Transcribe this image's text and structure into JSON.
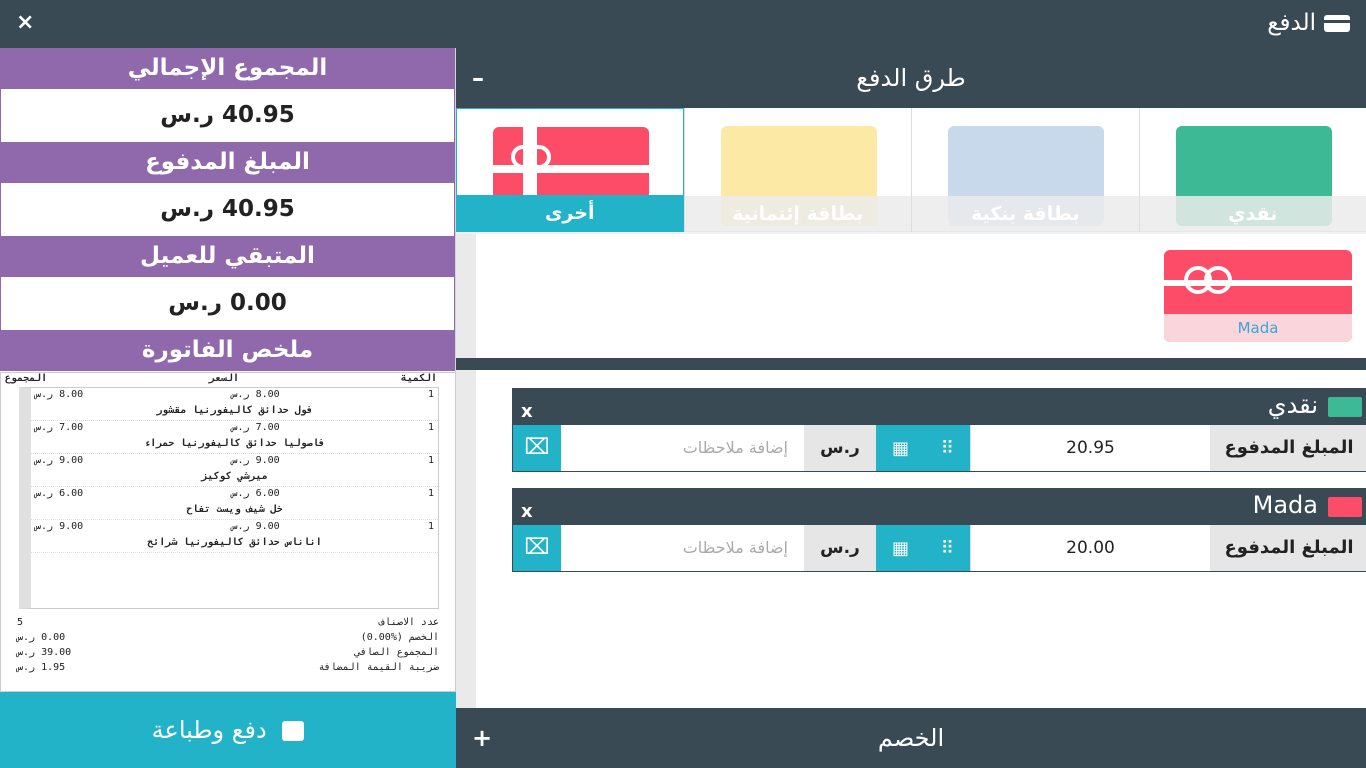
{
  "header": {
    "title": "الدفع",
    "close_label": "×"
  },
  "summary": {
    "total_label": "المجموع الإجمالي",
    "total_value": "40.95 ر.س",
    "paid_label": "المبلغ المدفوع",
    "paid_value": "40.95 ر.س",
    "remaining_label": "المتبقي للعميل",
    "remaining_value": "0.00 ر.س",
    "invoice_label": "ملخص الفاتورة"
  },
  "receipt": {
    "headers": {
      "qty": "الكمية",
      "price": "السعر",
      "total": "المجموع"
    },
    "items": [
      {
        "qty": "1",
        "price": "8.00 ر.س",
        "total": "8.00 ر.س",
        "name": "فول حدائق كاليفورنيا مقشور"
      },
      {
        "qty": "1",
        "price": "7.00 ر.س",
        "total": "7.00 ر.س",
        "name": "فاصوليا حدائق كاليفورنيا حمراء"
      },
      {
        "qty": "1",
        "price": "9.00 ر.س",
        "total": "9.00 ر.س",
        "name": "ميرشي كوكيز"
      },
      {
        "qty": "1",
        "price": "6.00 ر.س",
        "total": "6.00 ر.س",
        "name": "خل شيف ويست تفاح"
      },
      {
        "qty": "1",
        "price": "9.00 ر.س",
        "total": "9.00 ر.س",
        "name": "اناناس حدائق كاليفورنيا شرائح"
      }
    ],
    "footer": [
      {
        "label": "عدد الاصناف",
        "value": "5"
      },
      {
        "label": "الخصم (%0.00)",
        "value": "0.00 ر.س"
      },
      {
        "label": "المجموع الصافي",
        "value": "39.00 ر.س"
      },
      {
        "label": "ضريبة القيمة المضافة",
        "value": "1.95 ر.س"
      }
    ]
  },
  "pay_button": "دفع وطباعة",
  "methods_section": {
    "title": "طرق الدفع",
    "toggle": "–"
  },
  "methods": [
    {
      "label": "نقدي",
      "color": "#3db995"
    },
    {
      "label": "بطاقة بنكية",
      "color": "#c8d9ec"
    },
    {
      "label": "بطاقة إئتمانية",
      "color": "#fde9a6"
    },
    {
      "label": "أخرى",
      "color": "#fd4c67"
    }
  ],
  "sub_option": {
    "label": "Mada"
  },
  "payments": [
    {
      "name": "نقدي",
      "icon": "cash-icon",
      "icon_color": "#3db995",
      "amount": "20.95",
      "currency": "ر.س",
      "notes_placeholder": "إضافة ملاحظات",
      "amount_label": "المبلغ المدفوع",
      "remove": "x"
    },
    {
      "name": "Mada",
      "icon": "gift-card-icon",
      "icon_color": "#fd4c67",
      "amount": "20.00",
      "currency": "ر.س",
      "notes_placeholder": "إضافة ملاحظات",
      "amount_label": "المبلغ المدفوع",
      "remove": "x"
    }
  ],
  "discount_section": {
    "title": "الخصم",
    "toggle": "+"
  }
}
